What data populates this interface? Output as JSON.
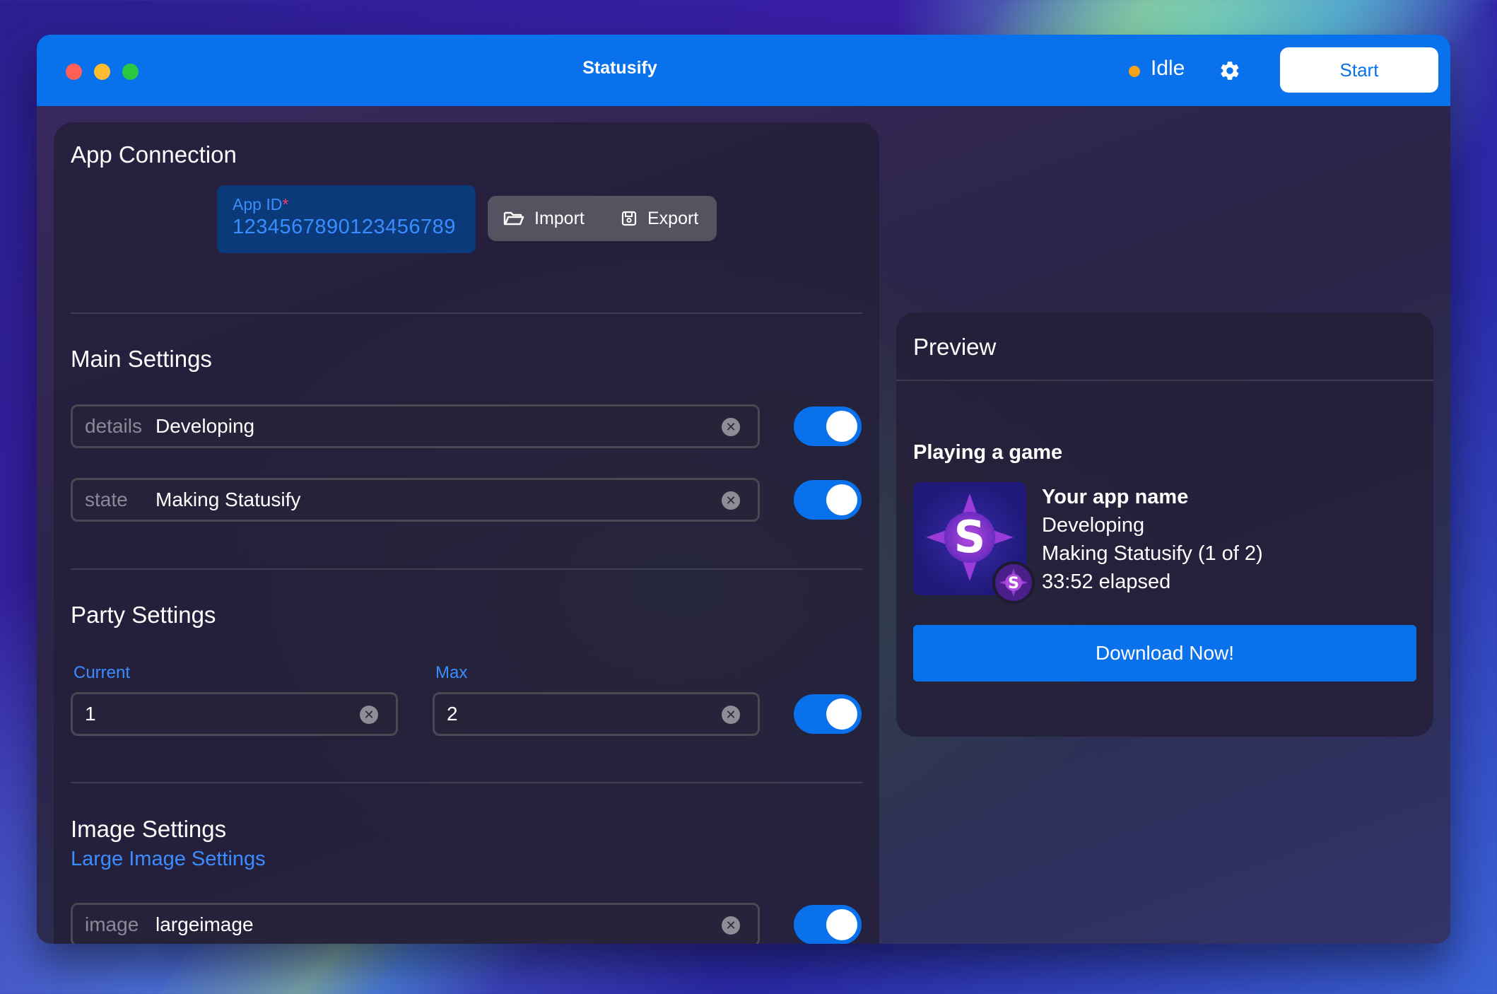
{
  "window": {
    "title": "Statusify",
    "status_text": "Idle",
    "status_color": "#f7a21b",
    "start_label": "Start",
    "accent_color": "#0a71ec"
  },
  "app_connection": {
    "heading": "App Connection",
    "app_id_label": "App ID",
    "app_id_required_mark": "*",
    "app_id_value": "1234567890123456789",
    "import_label": "Import",
    "export_label": "Export"
  },
  "main_settings": {
    "heading": "Main Settings",
    "fields": [
      {
        "label": "details",
        "value": "Developing",
        "enabled": true
      },
      {
        "label": "state",
        "value": "Making Statusify",
        "enabled": true
      }
    ]
  },
  "party_settings": {
    "heading": "Party Settings",
    "current_label": "Current",
    "current_value": "1",
    "max_label": "Max",
    "max_value": "2",
    "enabled": true
  },
  "image_settings": {
    "heading": "Image Settings",
    "large_image_link": "Large Image Settings",
    "image_field_label": "image",
    "image_field_value": "largeimage",
    "enabled": true
  },
  "preview": {
    "heading": "Preview",
    "activity_heading": "Playing a game",
    "app_name": "Your app name",
    "details": "Developing",
    "state": "Making Statusify (1 of 2)",
    "elapsed": "33:52 elapsed",
    "image_letter": "S",
    "download_label": "Download Now!"
  }
}
